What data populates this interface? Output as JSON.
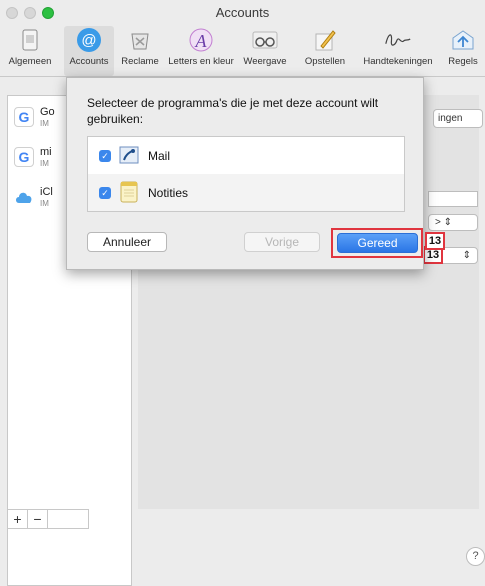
{
  "window": {
    "title": "Accounts"
  },
  "toolbar": {
    "items": [
      {
        "label": "Algemeen",
        "icon": "general-icon"
      },
      {
        "label": "Accounts",
        "icon": "at-icon"
      },
      {
        "label": "Reclame",
        "icon": "junk-mail-icon"
      },
      {
        "label": "Letters en kleur",
        "icon": "fonts-colors-icon"
      },
      {
        "label": "Weergave",
        "icon": "viewing-glasses-icon"
      },
      {
        "label": "Opstellen",
        "icon": "composing-pencil-icon"
      },
      {
        "label": "Handtekeningen",
        "icon": "signature-icon"
      },
      {
        "label": "Regels",
        "icon": "rules-icon"
      }
    ],
    "selected": "Accounts"
  },
  "sidebar": {
    "accounts": [
      {
        "name": "Go",
        "sub": "IM",
        "icon": "google-icon"
      },
      {
        "name": "mi",
        "sub": "IM",
        "icon": "google-icon"
      },
      {
        "name": "iCl",
        "sub": "IM",
        "icon": "icloud-icon"
      }
    ],
    "add_label": "+",
    "remove_label": "−"
  },
  "detail": {
    "button_fragment": "ingen",
    "popup1_fragment": ">",
    "badge_number": "13"
  },
  "sheet": {
    "prompt": "Selecteer de programma's die je met deze account wilt gebruiken:",
    "apps": [
      {
        "name": "Mail",
        "checked": true,
        "icon": "mail-stamp-icon"
      },
      {
        "name": "Notities",
        "checked": true,
        "icon": "notes-icon"
      }
    ],
    "cancel_label": "Annuleer",
    "prev_label": "Vorige",
    "done_label": "Gereed",
    "badge_number": "13"
  },
  "help_label": "?",
  "colors": {
    "accent": "#2a75e6",
    "highlight": "#e0353f",
    "zoom": "#2dc042"
  }
}
